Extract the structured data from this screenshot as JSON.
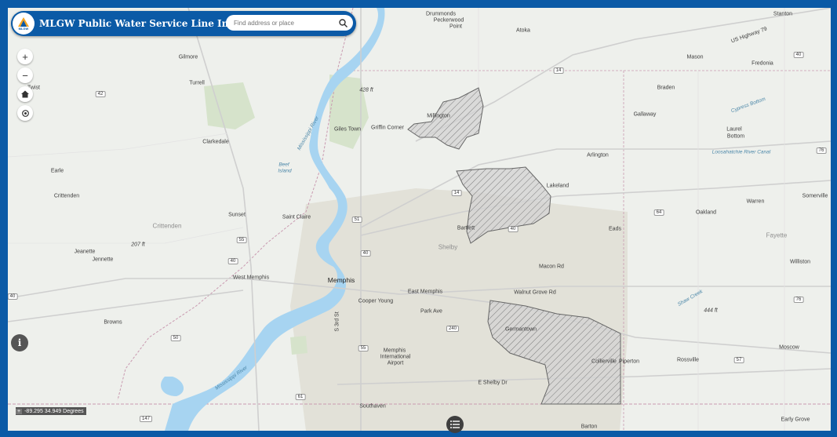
{
  "header": {
    "title": "MLGW Public Water Service Line Inventory",
    "logo_text": "MLGW"
  },
  "search": {
    "placeholder": "Find address or place"
  },
  "controls": {
    "zoom_in": "+",
    "zoom_out": "−",
    "info": "i"
  },
  "coordinates": {
    "text": "-89.295 34.949 Degrees"
  },
  "map": {
    "colors": {
      "land": "#eef0ec",
      "water": "#a7d4f1",
      "urban": "#e2e1d8",
      "park": "#d6e3cb",
      "service_area_fill": "#d3d3d3",
      "service_area_stroke": "#666666",
      "county_line": "#c99ab0"
    },
    "places": [
      {
        "name": "Drummonds",
        "type": "city"
      },
      {
        "name": "Peckerwood",
        "type": "city"
      },
      {
        "name": "Point",
        "type": "city"
      },
      {
        "name": "Atoka",
        "type": "city"
      },
      {
        "name": "Stanton",
        "type": "city"
      },
      {
        "name": "Gilmore",
        "type": "city"
      },
      {
        "name": "Turrell",
        "type": "city"
      },
      {
        "name": "Twist",
        "type": "city"
      },
      {
        "name": "Mason",
        "type": "city"
      },
      {
        "name": "Fredonia",
        "type": "city"
      },
      {
        "name": "Braden",
        "type": "city"
      },
      {
        "name": "Gallaway",
        "type": "city"
      },
      {
        "name": "Millington",
        "type": "city"
      },
      {
        "name": "Giles Town",
        "type": "city"
      },
      {
        "name": "Griffin Corner",
        "type": "city"
      },
      {
        "name": "Clarkedale",
        "type": "city"
      },
      {
        "name": "Laurel",
        "type": "city"
      },
      {
        "name": "Bottom",
        "type": "city"
      },
      {
        "name": "Arlington",
        "type": "city"
      },
      {
        "name": "Earle",
        "type": "city"
      },
      {
        "name": "Crittenden",
        "type": "city"
      },
      {
        "name": "Lakeland",
        "type": "city"
      },
      {
        "name": "Somerville",
        "type": "city"
      },
      {
        "name": "Sunset",
        "type": "city"
      },
      {
        "name": "Saint Claire",
        "type": "city"
      },
      {
        "name": "Warren",
        "type": "city"
      },
      {
        "name": "Oakland",
        "type": "city"
      },
      {
        "name": "Bartlett",
        "type": "city"
      },
      {
        "name": "Eads",
        "type": "city"
      },
      {
        "name": "Fayette",
        "type": "region"
      },
      {
        "name": "Crittenden",
        "type": "region"
      },
      {
        "name": "Shelby",
        "type": "region"
      },
      {
        "name": "Jeanette",
        "type": "city"
      },
      {
        "name": "Jennette",
        "type": "city"
      },
      {
        "name": "Williston",
        "type": "city"
      },
      {
        "name": "West Memphis",
        "type": "city"
      },
      {
        "name": "Memphis",
        "type": "major"
      },
      {
        "name": "East Memphis",
        "type": "city"
      },
      {
        "name": "Cooper Young",
        "type": "city"
      },
      {
        "name": "Browns",
        "type": "city"
      },
      {
        "name": "Germantown",
        "type": "city"
      },
      {
        "name": "Memphis",
        "type": "city"
      },
      {
        "name": "International",
        "type": "city"
      },
      {
        "name": "Airport",
        "type": "city"
      },
      {
        "name": "Moscow",
        "type": "city"
      },
      {
        "name": "Collierville",
        "type": "city"
      },
      {
        "name": "Piperton",
        "type": "city"
      },
      {
        "name": "Rossville",
        "type": "city"
      },
      {
        "name": "Southaven",
        "type": "city"
      },
      {
        "name": "Barton",
        "type": "city"
      },
      {
        "name": "Early Grove",
        "type": "city"
      }
    ],
    "water_labels": [
      {
        "name": "Mississippi River"
      },
      {
        "name": "Mississippi River"
      },
      {
        "name": "Beef"
      },
      {
        "name": "Island"
      },
      {
        "name": "Cypress Bottom"
      },
      {
        "name": "Loosahatchie River Canal"
      },
      {
        "name": "Shaw Creek"
      }
    ],
    "road_labels": [
      {
        "name": "US Highway 79"
      },
      {
        "name": "Macon Rd"
      },
      {
        "name": "Walnut Grove Rd"
      },
      {
        "name": "Park Ave"
      },
      {
        "name": "E Shelby Dr"
      },
      {
        "name": "S 3rd St"
      }
    ],
    "elevations": [
      "428 ft",
      "207 ft",
      "444 ft"
    ],
    "shields": [
      "14",
      "42",
      "14",
      "55",
      "40",
      "51",
      "40",
      "40",
      "40",
      "64",
      "50",
      "55",
      "240",
      "61",
      "147",
      "57",
      "76",
      "76",
      "40"
    ]
  }
}
